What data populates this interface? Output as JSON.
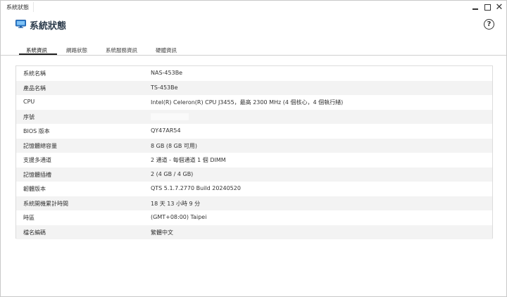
{
  "window": {
    "title": "系統狀態"
  },
  "header": {
    "title": "系統狀態",
    "app_icon": "monitor-icon",
    "help_icon": "help-icon"
  },
  "tabs": [
    {
      "label": "系統資訊",
      "active": true
    },
    {
      "label": "網路狀態",
      "active": false
    },
    {
      "label": "系統服務資訊",
      "active": false
    },
    {
      "label": "硬體資訊",
      "active": false
    }
  ],
  "system_info": {
    "rows": [
      {
        "label": "系統名稱",
        "value": "NAS-453Be"
      },
      {
        "label": "產品名稱",
        "value": "TS-453Be"
      },
      {
        "label": "CPU",
        "value": "Intel(R) Celeron(R) CPU J3455，最高 2300 MHz (4 個核心，4 個執行緒)"
      },
      {
        "label": "序號",
        "value": ""
      },
      {
        "label": "BIOS 版本",
        "value": "QY47AR54"
      },
      {
        "label": "記憶體總容量",
        "value": "8 GB (8 GB 可用)"
      },
      {
        "label": "支援多通道",
        "value": "2 通道 - 每個通道 1 個 DIMM"
      },
      {
        "label": "記憶體插槽",
        "value": "2 (4 GB / 4 GB)"
      },
      {
        "label": "韌體版本",
        "value": "QTS 5.1.7.2770 Build 20240520"
      },
      {
        "label": "系統開機累計時間",
        "value": "18 天 13 小時 9 分"
      },
      {
        "label": "時區",
        "value": "(GMT+08:00) Taipei"
      },
      {
        "label": "檔名編碼",
        "value": "繁體中文"
      }
    ]
  },
  "colors": {
    "accent_icon": "#2f7fd1",
    "stripe": "#f3f3f3",
    "border": "#dcdcdc"
  }
}
